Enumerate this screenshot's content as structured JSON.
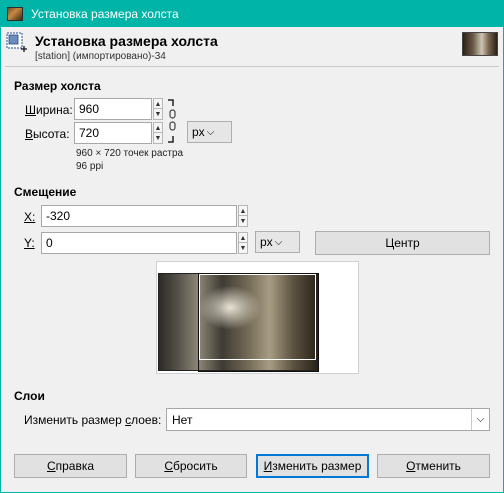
{
  "window": {
    "title": "Установка размера холста"
  },
  "header": {
    "title": "Установка размера холста",
    "subtitle": "[station] (импортировано)-34"
  },
  "canvas_size": {
    "section_label": "Размер холста",
    "width_label": "Ширина:",
    "width_label_mnemonic": "Ш",
    "width_label_rest": "ирина:",
    "width_value": "960",
    "height_label": "Высота:",
    "height_label_mnemonic": "В",
    "height_label_rest": "ысота:",
    "height_value": "720",
    "unit": "px",
    "info_pixels": "960 × 720 точек растра",
    "info_ppi": "96 ppi"
  },
  "offset": {
    "section_label": "Смещение",
    "x_label": "X:",
    "x_value": "-320",
    "y_label": "Y:",
    "y_value": "0",
    "unit": "px",
    "center_button": "Центр"
  },
  "layers": {
    "section_label": "Слои",
    "resize_label": "Изменить размер слоев:",
    "resize_label_pre": "Изменить размер ",
    "resize_label_mnemonic": "с",
    "resize_label_post": "лоев:",
    "resize_value": "Нет"
  },
  "buttons": {
    "help": "Справка",
    "help_pre": "",
    "help_mnemonic": "С",
    "help_post": "правка",
    "reset": "Сбросить",
    "reset_pre": "",
    "reset_mnemonic": "С",
    "reset_post": "бросить",
    "resize": "Изменить размер",
    "resize_pre": "",
    "resize_mnemonic": "И",
    "resize_post": "зменить размер",
    "cancel": "Отменить",
    "cancel_pre": "",
    "cancel_mnemonic": "О",
    "cancel_post": "тменить"
  },
  "icons": {
    "app": "image-app-icon",
    "canvas_size": "canvas-size-icon",
    "chain": "chain-link-icon",
    "spin_up": "triangle-up-icon",
    "spin_down": "triangle-down-icon",
    "dropdown": "chevron-down-icon"
  },
  "colors": {
    "titlebar": "#00b4a8",
    "default_button_border": "#0078d7"
  }
}
